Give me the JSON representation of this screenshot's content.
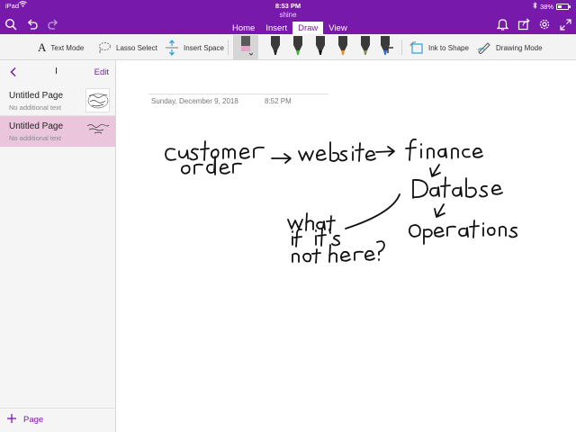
{
  "status_bar": {
    "device": "iPad",
    "time": "8:53 PM",
    "battery": "38%",
    "battery_level": 0.38
  },
  "notebook_title": "shine",
  "tabs": [
    {
      "label": "Home",
      "active": false
    },
    {
      "label": "Insert",
      "active": false
    },
    {
      "label": "Draw",
      "active": true
    },
    {
      "label": "View",
      "active": false
    }
  ],
  "ribbon": {
    "text_mode": "Text Mode",
    "lasso_select": "Lasso Select",
    "insert_space": "Insert Space",
    "ink_to_shape": "Ink to Shape",
    "drawing_mode": "Drawing Mode"
  },
  "pens": [
    {
      "name": "highlighter-pink",
      "color": "#e7a3c8",
      "selected": true
    },
    {
      "name": "pen-black",
      "color": "#222222"
    },
    {
      "name": "pen-green",
      "color": "#3fae3a"
    },
    {
      "name": "marker-black",
      "color": "#111111"
    },
    {
      "name": "pen-orange",
      "color": "#e8892b"
    },
    {
      "name": "pen-gold",
      "color": "#8a8a5a"
    },
    {
      "name": "pen-blue",
      "color": "#3d6bd6"
    }
  ],
  "panel": {
    "section_name": "I",
    "edit_label": "Edit",
    "pages": [
      {
        "title": "Untitled Page",
        "subtitle": "No additional text",
        "selected": false
      },
      {
        "title": "Untitled Page",
        "subtitle": "No additional text",
        "selected": true
      }
    ],
    "add_page_label": "Page"
  },
  "page": {
    "date": "Sunday, December 9, 2018",
    "time": "8:52 PM"
  },
  "ink_words": [
    "customer",
    "order",
    "website",
    "finance",
    "Database",
    "Operations",
    "what",
    "if it's",
    "not here?"
  ],
  "colors": {
    "accent": "#7719aa",
    "selected_page": "#ebc5dc",
    "ribbon_bg": "#f3f3f3"
  }
}
